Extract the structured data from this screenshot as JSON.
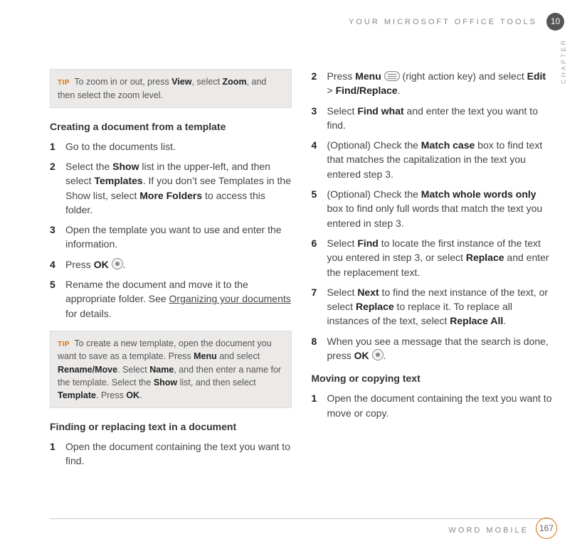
{
  "header": {
    "running_head": "YOUR MICROSOFT OFFICE TOOLS",
    "chapter_number": "10",
    "chapter_tab": "CHAPTER"
  },
  "footer": {
    "label": "WORD MOBILE",
    "page_number": "167"
  },
  "tip_label": "TIP",
  "left": {
    "tip1": {
      "t1": "To zoom in or out, press ",
      "b1": "View",
      "t2": ", select ",
      "b2": "Zoom",
      "t3": ", and then select the zoom level."
    },
    "h1": "Creating a document from a template",
    "l1": {
      "s1": "Go to the documents list.",
      "s2a": "Select the ",
      "s2b": "Show",
      "s2c": " list in the upper-left, and then select ",
      "s2d": "Templates",
      "s2e": ". If you don’t see Templates in the Show list, select ",
      "s2f": "More Folders",
      "s2g": " to access this folder.",
      "s3": "Open the template you want to use and enter the information.",
      "s4a": "Press ",
      "s4b": "OK",
      "s4c": " ",
      "s4d": ".",
      "s5a": "Rename the document and move it to the appropriate folder. See ",
      "s5b": "Organizing your documents",
      "s5c": " for details."
    },
    "tip2": {
      "t1": "To create a new template, open the document you want to save as a template. Press ",
      "b1": "Menu",
      "t2": " and select ",
      "b2": "Rename/Move",
      "t3": ". Select ",
      "b3": "Name",
      "t4": ", and then enter a name for the template. Select the ",
      "b4": "Show",
      "t5": " list, and then select ",
      "b5": "Template",
      "t6": ". Press ",
      "b6": "OK",
      "t7": "."
    },
    "h2": "Finding or replacing text in a document",
    "l2": {
      "s1": "Open the document containing the text you want to find."
    }
  },
  "right": {
    "l3": {
      "s2a": "Press ",
      "s2b": "Menu",
      "s2c": " ",
      "s2d": " (right action key) and select ",
      "s2e": "Edit",
      "s2f": " > ",
      "s2g": "Find/Replace",
      "s2h": ".",
      "s3a": "Select ",
      "s3b": "Find what",
      "s3c": " and enter the text you want to find.",
      "s4a": "(Optional)  Check the ",
      "s4b": "Match case",
      "s4c": " box to find text that matches the capitalization in the text you entered step 3.",
      "s5a": "(Optional)  Check the ",
      "s5b": "Match whole words only",
      "s5c": " box to find only full words that match the text you entered in step 3.",
      "s6a": "Select ",
      "s6b": "Find",
      "s6c": " to locate the first instance of the text you entered in step 3, or select ",
      "s6d": "Replace",
      "s6e": " and enter the replacement text.",
      "s7a": "Select ",
      "s7b": "Next",
      "s7c": " to find the next instance of the text, or select ",
      "s7d": "Replace",
      "s7e": " to replace it. To replace all instances of the text, select ",
      "s7f": "Replace All",
      "s7g": ".",
      "s8a": "When you see a message that the search is done, press ",
      "s8b": "OK",
      "s8c": " ",
      "s8d": "."
    },
    "h3": "Moving or copying text",
    "l4": {
      "s1": "Open the document containing the text you want to move or copy."
    }
  },
  "nums": {
    "n1": "1",
    "n2": "2",
    "n3": "3",
    "n4": "4",
    "n5": "5",
    "n6": "6",
    "n7": "7",
    "n8": "8"
  }
}
